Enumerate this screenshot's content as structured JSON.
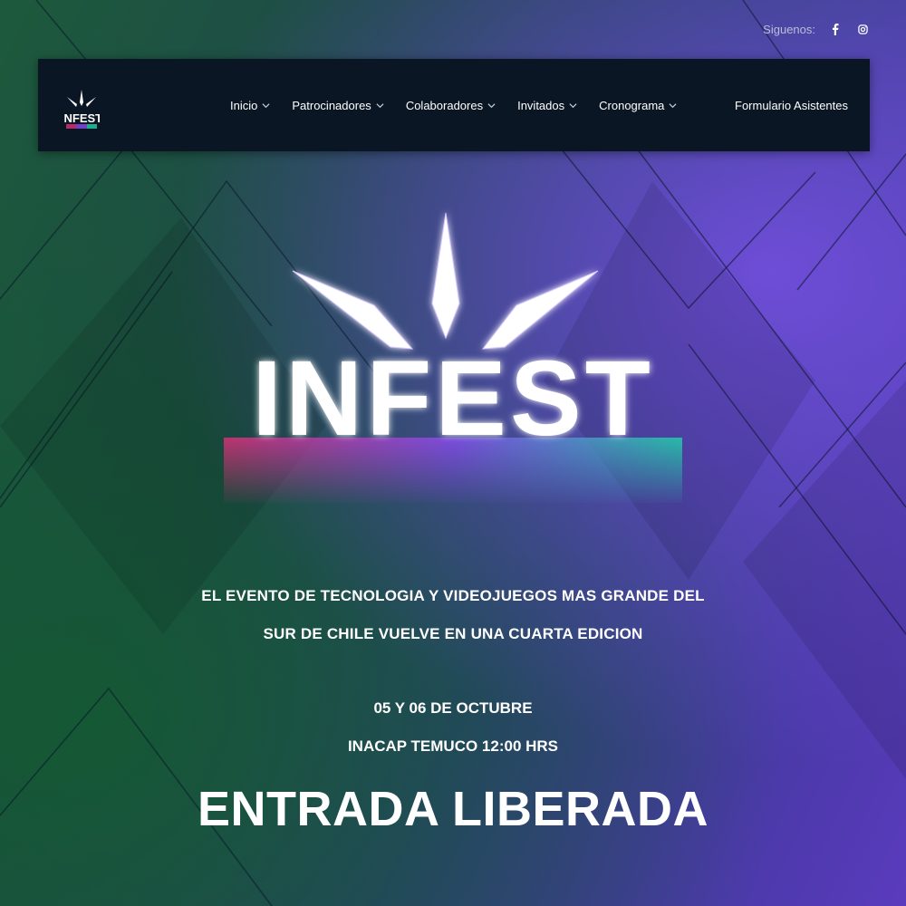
{
  "social": {
    "label": "Siguenos:",
    "icons": [
      "facebook-icon",
      "instagram-icon"
    ]
  },
  "nav": {
    "logo_text": "INFEST",
    "items": [
      {
        "label": "Inicio",
        "icon": "chevron-down-icon"
      },
      {
        "label": "Patrocinadores",
        "icon": "chevron-down-icon"
      },
      {
        "label": "Colaboradores",
        "icon": "chevron-down-icon"
      },
      {
        "label": "Invitados",
        "icon": "chevron-down-icon"
      },
      {
        "label": "Cronograma",
        "icon": "chevron-down-icon"
      }
    ],
    "cta": "Formulario Asistentes"
  },
  "hero": {
    "logo_text": "INFEST",
    "tagline_line1": "EL EVENTO DE TECNOLOGIA Y VIDEOJUEGOS MAS GRANDE DEL",
    "tagline_line2": "SUR DE CHILE VUELVE EN UNA CUARTA EDICION",
    "date": "05 Y 06 DE OCTUBRE",
    "venue": "INACAP TEMUCO 12:00 HRS",
    "headline": "ENTRADA LIBERADA"
  },
  "colors": {
    "navbar_bg": "#0b1624",
    "logo_pink": "#e0307a",
    "logo_purple": "#8a4cf0",
    "logo_teal": "#1fd6a8"
  }
}
